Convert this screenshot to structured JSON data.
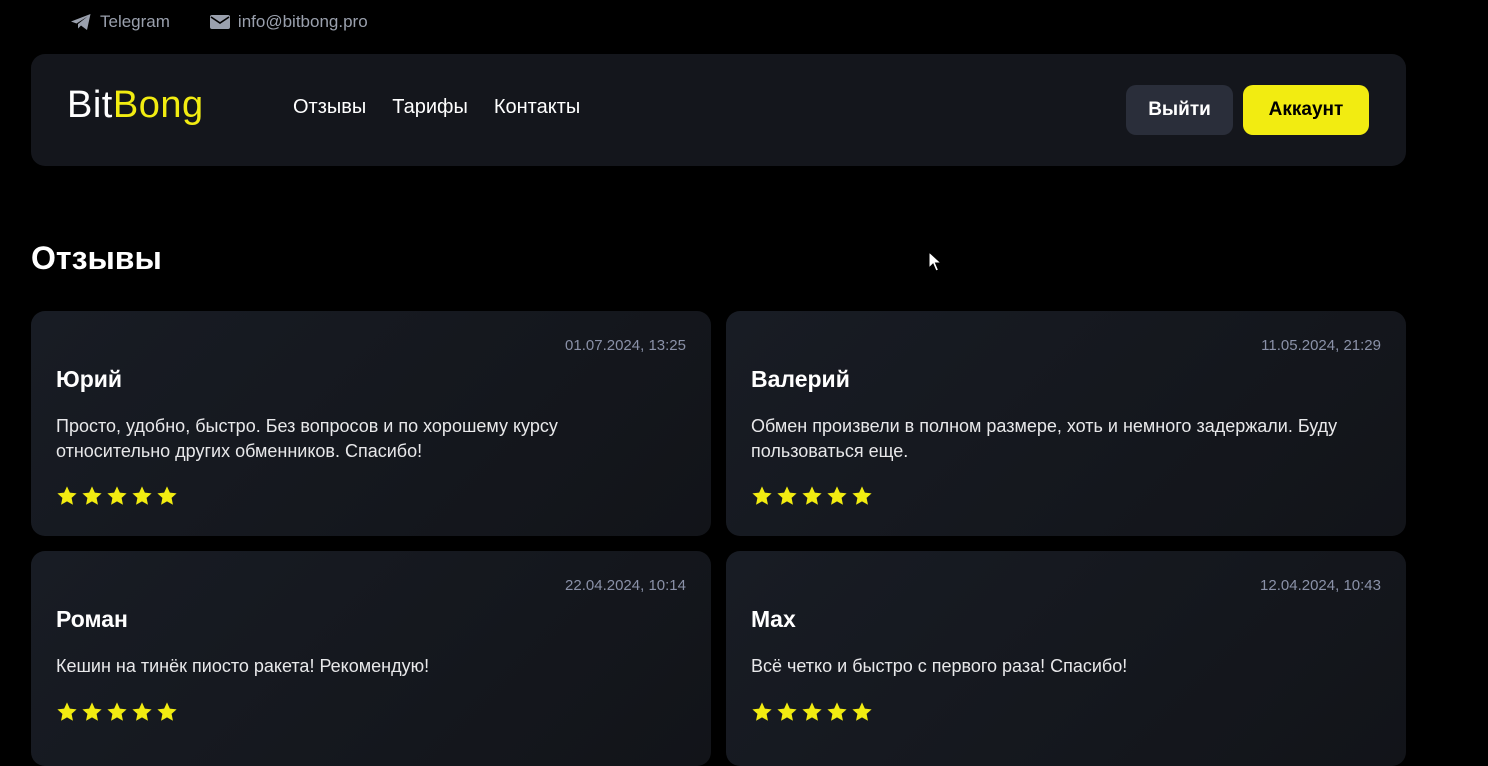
{
  "topbar": {
    "telegram_label": "Telegram",
    "email_label": "info@bitbong.pro"
  },
  "header": {
    "logo_part1": "Bit",
    "logo_part2": "Bong",
    "nav": [
      "Отзывы",
      "Тарифы",
      "Контакты"
    ],
    "logout_label": "Выйти",
    "account_label": "Аккаунт"
  },
  "colors": {
    "accent": "#f2ec11",
    "background": "#000000",
    "card": "#14161c"
  },
  "reviews": {
    "title": "Отзывы",
    "items": [
      {
        "date": "01.07.2024, 13:25",
        "name": "Юрий",
        "text": "Просто, удобно, быстро. Без вопросов и по хорошему курсу относительно других обменников. Спасибо!",
        "rating": 5
      },
      {
        "date": "11.05.2024, 21:29",
        "name": "Валерий",
        "text": "Обмен произвели в полном размере, хоть и немного задержали. Буду пользоваться еще.",
        "rating": 5
      },
      {
        "date": "22.04.2024, 10:14",
        "name": "Роман",
        "text": "Кешин на тинёк пиосто ракета! Рекомендую!",
        "rating": 5
      },
      {
        "date": "12.04.2024, 10:43",
        "name": "Max",
        "text": "Всё четко и быстро с первого раза! Спасибо!",
        "rating": 5
      }
    ]
  }
}
